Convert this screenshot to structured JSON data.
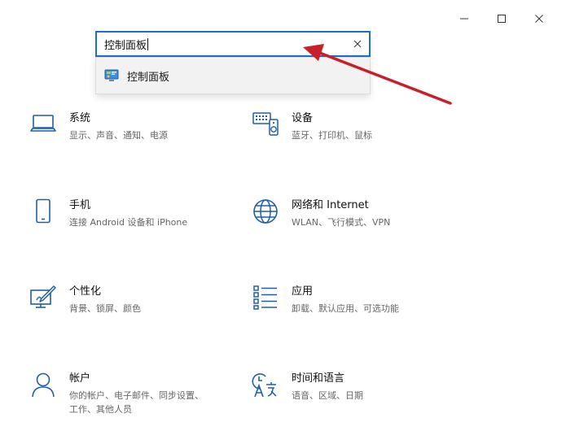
{
  "window": {
    "controls": [
      "minimize",
      "maximize",
      "close"
    ]
  },
  "search": {
    "value": "控制面板",
    "clear_icon": "close-icon"
  },
  "suggestions": [
    {
      "label": "控制面板",
      "icon": "control-panel-icon"
    }
  ],
  "tiles": [
    {
      "id": "system",
      "title": "系统",
      "desc": "显示、声音、通知、电源",
      "icon": "laptop-icon"
    },
    {
      "id": "devices",
      "title": "设备",
      "desc": "蓝牙、打印机、鼠标",
      "icon": "keyboard-speaker-icon"
    },
    {
      "id": "phone",
      "title": "手机",
      "desc": "连接 Android 设备和 iPhone",
      "icon": "phone-icon"
    },
    {
      "id": "network",
      "title": "网络和 Internet",
      "desc": "WLAN、飞行模式、VPN",
      "icon": "globe-icon"
    },
    {
      "id": "personal",
      "title": "个性化",
      "desc": "背景、锁屏、颜色",
      "icon": "paint-icon"
    },
    {
      "id": "apps",
      "title": "应用",
      "desc": "卸载、默认应用、可选功能",
      "icon": "app-list-icon"
    },
    {
      "id": "accounts",
      "title": "帐户",
      "desc": "你的帐户、电子邮件、同步设置、工作、其他人员",
      "icon": "person-icon"
    },
    {
      "id": "time",
      "title": "时间和语言",
      "desc": "语音、区域、日期",
      "icon": "time-language-icon"
    }
  ],
  "colors": {
    "accent": "#1a6fc9",
    "icon": "#1f5fa8",
    "annotation_arrow": "#c8202a"
  }
}
